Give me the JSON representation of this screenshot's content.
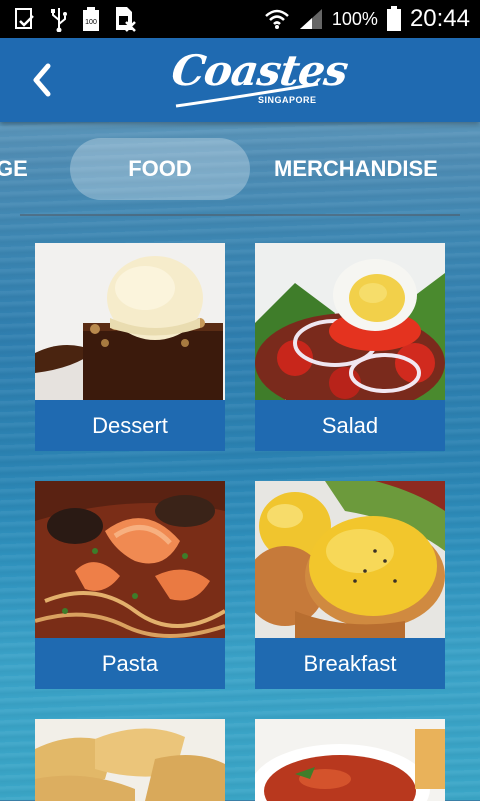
{
  "status_bar": {
    "battery_percent": "100%",
    "time": "20:44",
    "battery_small_label": "100"
  },
  "app_bar": {
    "logo_text": "Coastes",
    "logo_subtext": "SINGAPORE"
  },
  "tabs": {
    "prev_partial": "GE",
    "active": "FOOD",
    "next": "MERCHANDISE"
  },
  "menu": {
    "items": [
      {
        "label": "Dessert",
        "icon": "dessert-photo"
      },
      {
        "label": "Salad",
        "icon": "salad-photo"
      },
      {
        "label": "Pasta",
        "icon": "pasta-photo"
      },
      {
        "label": "Breakfast",
        "icon": "breakfast-photo"
      }
    ]
  },
  "colors": {
    "header_blue": "#1f6ab1",
    "tile_label_blue": "#1f6ab1",
    "status_bar": "#000000"
  }
}
